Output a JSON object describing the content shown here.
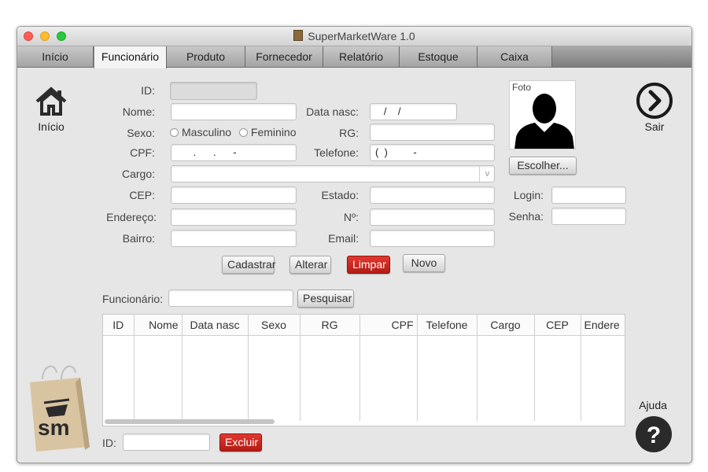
{
  "window": {
    "title": "SuperMarketWare 1.0",
    "traffic_lights": [
      "#ff5f57",
      "#febc2e",
      "#28c840"
    ]
  },
  "tabs": [
    {
      "label": "Início",
      "active": false
    },
    {
      "label": "Funcionário",
      "active": true
    },
    {
      "label": "Produto",
      "active": false
    },
    {
      "label": "Fornecedor",
      "active": false
    },
    {
      "label": "Relatório",
      "active": false
    },
    {
      "label": "Estoque",
      "active": false
    },
    {
      "label": "Caixa",
      "active": false
    }
  ],
  "sidebar": {
    "home_label": "Início",
    "exit_label": "Sair",
    "help_label": "Ajuda"
  },
  "form": {
    "id_label": "ID:",
    "id_value": "",
    "nome_label": "Nome:",
    "nome_value": "",
    "datanasc_label": "Data nasc:",
    "datanasc_value": "   /    /",
    "sexo_label": "Sexo:",
    "sexo_options": [
      "Masculino",
      "Feminino"
    ],
    "rg_label": "RG:",
    "rg_value": "",
    "cpf_label": "CPF:",
    "cpf_value": "      .      .      -",
    "telefone_label": "Telefone:",
    "telefone_value": "(  )         -",
    "cargo_label": "Cargo:",
    "cargo_value": "",
    "cep_label": "CEP:",
    "cep_value": "",
    "estado_label": "Estado:",
    "estado_value": "",
    "endereco_label": "Endereço:",
    "endereco_value": "",
    "numero_label": "Nº:",
    "numero_value": "",
    "bairro_label": "Bairro:",
    "bairro_value": "",
    "email_label": "Email:",
    "email_value": "",
    "login_label": "Login:",
    "login_value": "",
    "senha_label": "Senha:",
    "senha_value": "",
    "photo_label": "Foto",
    "choose_button": "Escolher..."
  },
  "actions": {
    "cadastrar": "Cadastrar",
    "alterar": "Alterar",
    "limpar": "Limpar",
    "novo": "Novo"
  },
  "search": {
    "label": "Funcionário:",
    "value": "",
    "button": "Pesquisar"
  },
  "table": {
    "columns": [
      "ID",
      "Nome",
      "Data nasc",
      "Sexo",
      "RG",
      "CPF",
      "Telefone",
      "Cargo",
      "CEP",
      "Endere"
    ],
    "rows": []
  },
  "delete_bar": {
    "id_label": "ID:",
    "id_value": "",
    "button": "Excluir"
  },
  "colors": {
    "accent_red": "#c8231b",
    "dark_icon": "#2b2b2b"
  },
  "icons": {
    "home": "house-icon",
    "exit": "arrow-right-circle-icon",
    "help": "question-circle-icon",
    "photo": "person-silhouette-icon",
    "logo": "shopping-bag-logo"
  }
}
